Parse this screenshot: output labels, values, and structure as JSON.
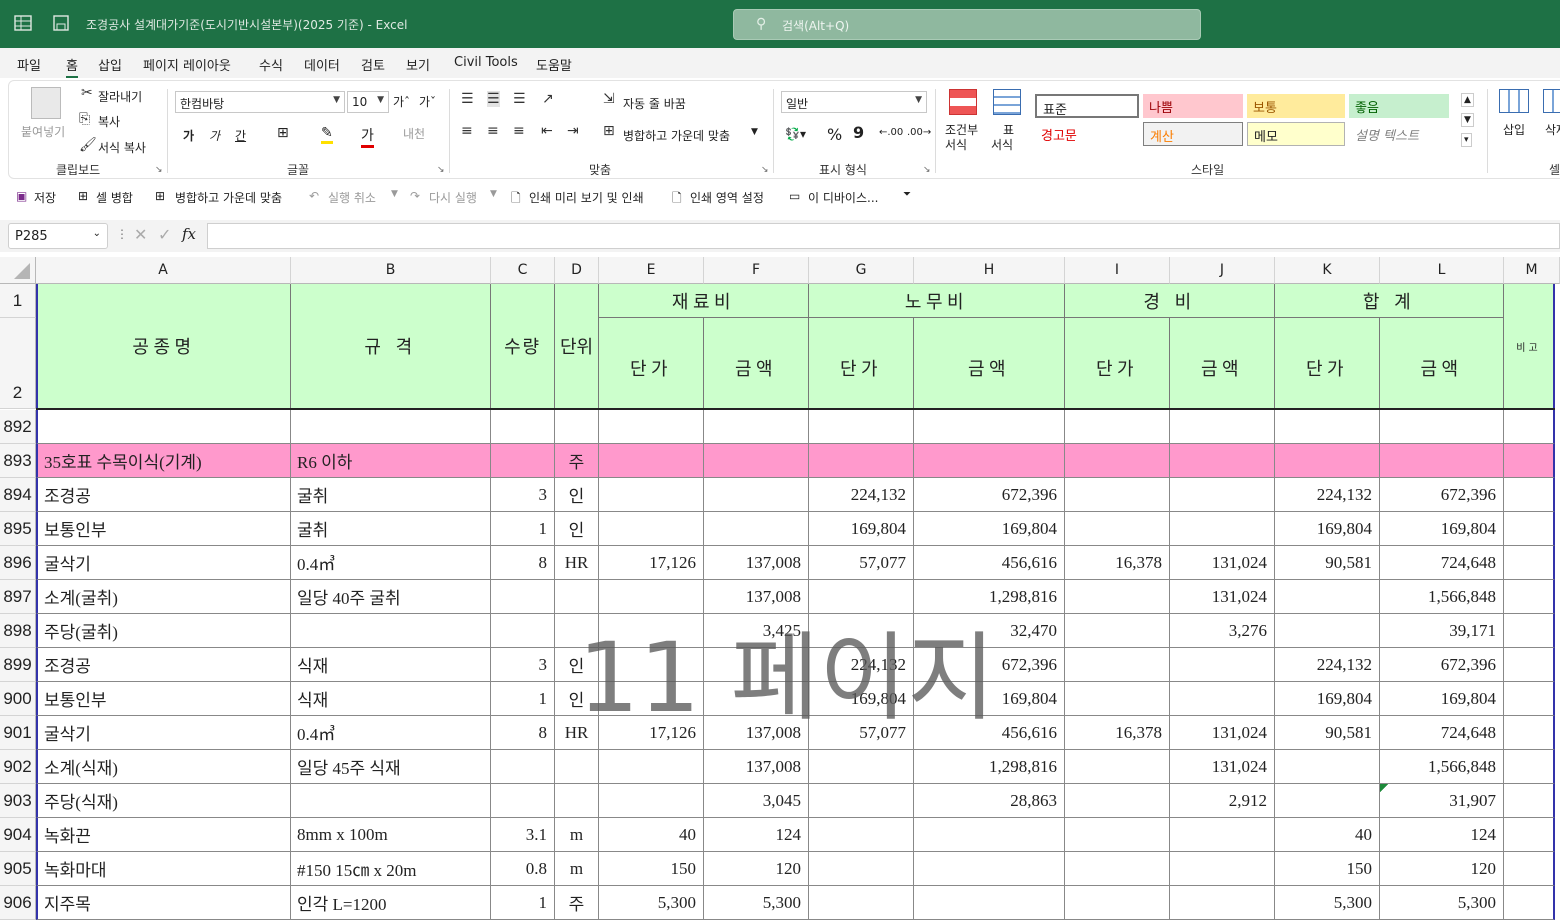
{
  "titlebar": {
    "title": "조경공사 설계대가기준(도시기반시설본부)(2025 기준)  -  Excel",
    "search_placeholder": "검색(Alt+Q)"
  },
  "menu": [
    "파일",
    "홈",
    "삽입",
    "페이지 레이아웃",
    "수식",
    "데이터",
    "검토",
    "보기",
    "Civil Tools",
    "도움말"
  ],
  "ribbon": {
    "paste": "붙여넣기",
    "cut": "잘라내기",
    "copy": "복사",
    "format_painter": "서식 복사",
    "clipboard": "클립보드",
    "font_name": "한컴바탕",
    "font_size": "10",
    "font_label": "글꼴",
    "wrap_text": "자동 줄 바꿈",
    "merge_center": "병합하고 가운데 맞춤",
    "alignment": "맞춤",
    "number_format": "일반",
    "number_label": "표시 형식",
    "cond_format_1": "조건부",
    "cond_format_2": "서식",
    "table_format_1": "표",
    "table_format_2": "서식",
    "styles": {
      "normal": "표준",
      "bad": "나쁨",
      "neutral": "보통",
      "good": "좋음",
      "warning": "경고문",
      "calc": "계산",
      "note": "메모",
      "explanatory": "설명 텍스트"
    },
    "styles_label": "스타일",
    "insert": "삽입",
    "delete": "삭제",
    "cells_label": "셀"
  },
  "qat": {
    "save": "저장",
    "merge": "셀 병합",
    "merge_center": "병합하고 가운데 맞춤",
    "undo": "실행 취소",
    "redo": "다시 실행",
    "print_preview": "인쇄 미리 보기 및 인쇄",
    "print_area": "인쇄 영역 설정",
    "device": "이 디바이스..."
  },
  "name_box": "P285",
  "columns": [
    "A",
    "B",
    "C",
    "D",
    "E",
    "F",
    "G",
    "H",
    "I",
    "J",
    "K",
    "L",
    "M"
  ],
  "header": {
    "name": "공종명",
    "spec": "규 격",
    "qty": "수량",
    "unit": "단위",
    "material": "재료비",
    "labor": "노무비",
    "expense": "경 비",
    "total": "합 계",
    "unit_price": "단가",
    "amount": "금액",
    "remark": "비고"
  },
  "rows": [
    {
      "n": "892",
      "a": "",
      "b": "",
      "c": "",
      "d": "",
      "e": "",
      "f": "",
      "g": "",
      "h": "",
      "i": "",
      "j": "",
      "k": "",
      "l": ""
    },
    {
      "n": "893",
      "a": "35호표 수목이식(기계)",
      "b": "R6 이하",
      "c": "",
      "d": "주",
      "e": "",
      "f": "",
      "g": "",
      "h": "",
      "i": "",
      "j": "",
      "k": "",
      "l": "",
      "highlight": "#ff99cc"
    },
    {
      "n": "894",
      "a": "조경공",
      "b": "굴취",
      "c": "3",
      "d": "인",
      "e": "",
      "f": "",
      "g": "224,132",
      "h": "672,396",
      "i": "",
      "j": "",
      "k": "224,132",
      "l": "672,396"
    },
    {
      "n": "895",
      "a": "보통인부",
      "b": "굴취",
      "c": "1",
      "d": "인",
      "e": "",
      "f": "",
      "g": "169,804",
      "h": "169,804",
      "i": "",
      "j": "",
      "k": "169,804",
      "l": "169,804"
    },
    {
      "n": "896",
      "a": "굴삭기",
      "b": "0.4㎥",
      "c": "8",
      "d": "HR",
      "e": "17,126",
      "f": "137,008",
      "g": "57,077",
      "h": "456,616",
      "i": "16,378",
      "j": "131,024",
      "k": "90,581",
      "l": "724,648"
    },
    {
      "n": "897",
      "a": "소계(굴취)",
      "b": "일당 40주 굴취",
      "c": "",
      "d": "",
      "e": "",
      "f": "137,008",
      "g": "",
      "h": "1,298,816",
      "i": "",
      "j": "131,024",
      "k": "",
      "l": "1,566,848"
    },
    {
      "n": "898",
      "a": "주당(굴취)",
      "b": "",
      "c": "",
      "d": "",
      "e": "",
      "f": "3,425",
      "g": "",
      "h": "32,470",
      "i": "",
      "j": "3,276",
      "k": "",
      "l": "39,171"
    },
    {
      "n": "899",
      "a": "조경공",
      "b": "식재",
      "c": "3",
      "d": "인",
      "e": "",
      "f": "",
      "g": "224,132",
      "h": "672,396",
      "i": "",
      "j": "",
      "k": "224,132",
      "l": "672,396"
    },
    {
      "n": "900",
      "a": "보통인부",
      "b": "식재",
      "c": "1",
      "d": "인",
      "e": "",
      "f": "",
      "g": "169,804",
      "h": "169,804",
      "i": "",
      "j": "",
      "k": "169,804",
      "l": "169,804"
    },
    {
      "n": "901",
      "a": "굴삭기",
      "b": "0.4㎥",
      "c": "8",
      "d": "HR",
      "e": "17,126",
      "f": "137,008",
      "g": "57,077",
      "h": "456,616",
      "i": "16,378",
      "j": "131,024",
      "k": "90,581",
      "l": "724,648"
    },
    {
      "n": "902",
      "a": "소계(식재)",
      "b": "일당 45주 식재",
      "c": "",
      "d": "",
      "e": "",
      "f": "137,008",
      "g": "",
      "h": "1,298,816",
      "i": "",
      "j": "131,024",
      "k": "",
      "l": "1,566,848"
    },
    {
      "n": "903",
      "a": "주당(식재)",
      "b": "",
      "c": "",
      "d": "",
      "e": "",
      "f": "3,045",
      "g": "",
      "h": "28,863",
      "i": "",
      "j": "2,912",
      "k": "",
      "l": "31,907"
    },
    {
      "n": "904",
      "a": "녹화끈",
      "b": "8mm x 100m",
      "c": "3.1",
      "d": "m",
      "e": "40",
      "f": "124",
      "g": "",
      "h": "",
      "i": "",
      "j": "",
      "k": "40",
      "l": "124"
    },
    {
      "n": "905",
      "a": "녹화마대",
      "b": "#150 15㎝ x 20m",
      "c": "0.8",
      "d": "m",
      "e": "150",
      "f": "120",
      "g": "",
      "h": "",
      "i": "",
      "j": "",
      "k": "150",
      "l": "120"
    },
    {
      "n": "906",
      "a": "지주목",
      "b": "인각 L=1200",
      "c": "1",
      "d": "주",
      "e": "5,300",
      "f": "5,300",
      "g": "",
      "h": "",
      "i": "",
      "j": "",
      "k": "5,300",
      "l": "5,300"
    }
  ],
  "watermark": "11 페이지",
  "colors": {
    "title_green": "#1e7145",
    "header_green": "#ccffcc",
    "row_pink": "#ff99cc"
  }
}
